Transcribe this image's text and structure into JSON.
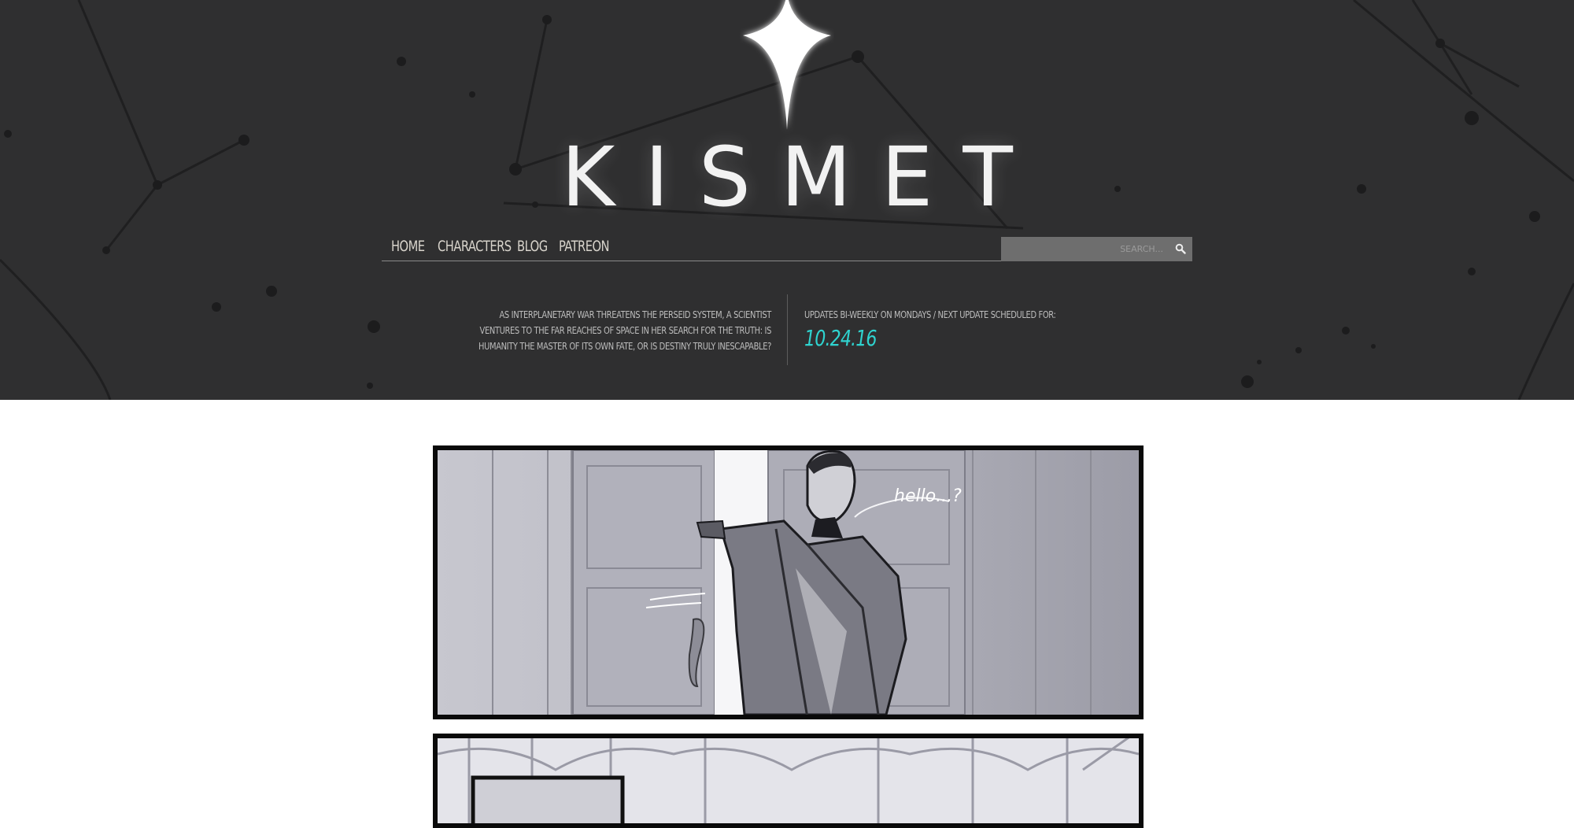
{
  "site": {
    "title": "KISMET",
    "logo_icon": "four-point-star-icon"
  },
  "nav": {
    "items": [
      {
        "label": "HOME"
      },
      {
        "label": "CHARACTERS"
      },
      {
        "label": "BLOG"
      },
      {
        "label": "PATREON"
      }
    ]
  },
  "search": {
    "placeholder": "SEARCH...",
    "icon": "search-icon"
  },
  "tagline": "AS INTERPLANETARY WAR THREATENS THE PERSEID SYSTEM, A SCIENTIST VENTURES TO THE FAR REACHES OF SPACE IN HER SEARCH FOR THE TRUTH: IS HUMANITY THE MASTER OF ITS OWN FATE, OR IS DESTINY TRULY INESCAPABLE?",
  "updates": {
    "schedule_text": "UPDATES BI-WEEKLY ON MONDAYS / NEXT UPDATE SCHEDULED FOR:",
    "next_date": "10.24.16"
  },
  "comic": {
    "speech_text": "hello...?"
  },
  "colors": {
    "header_bg": "#2f2f30",
    "accent": "#2fd3cf",
    "nav_text": "#d8d4cc"
  }
}
